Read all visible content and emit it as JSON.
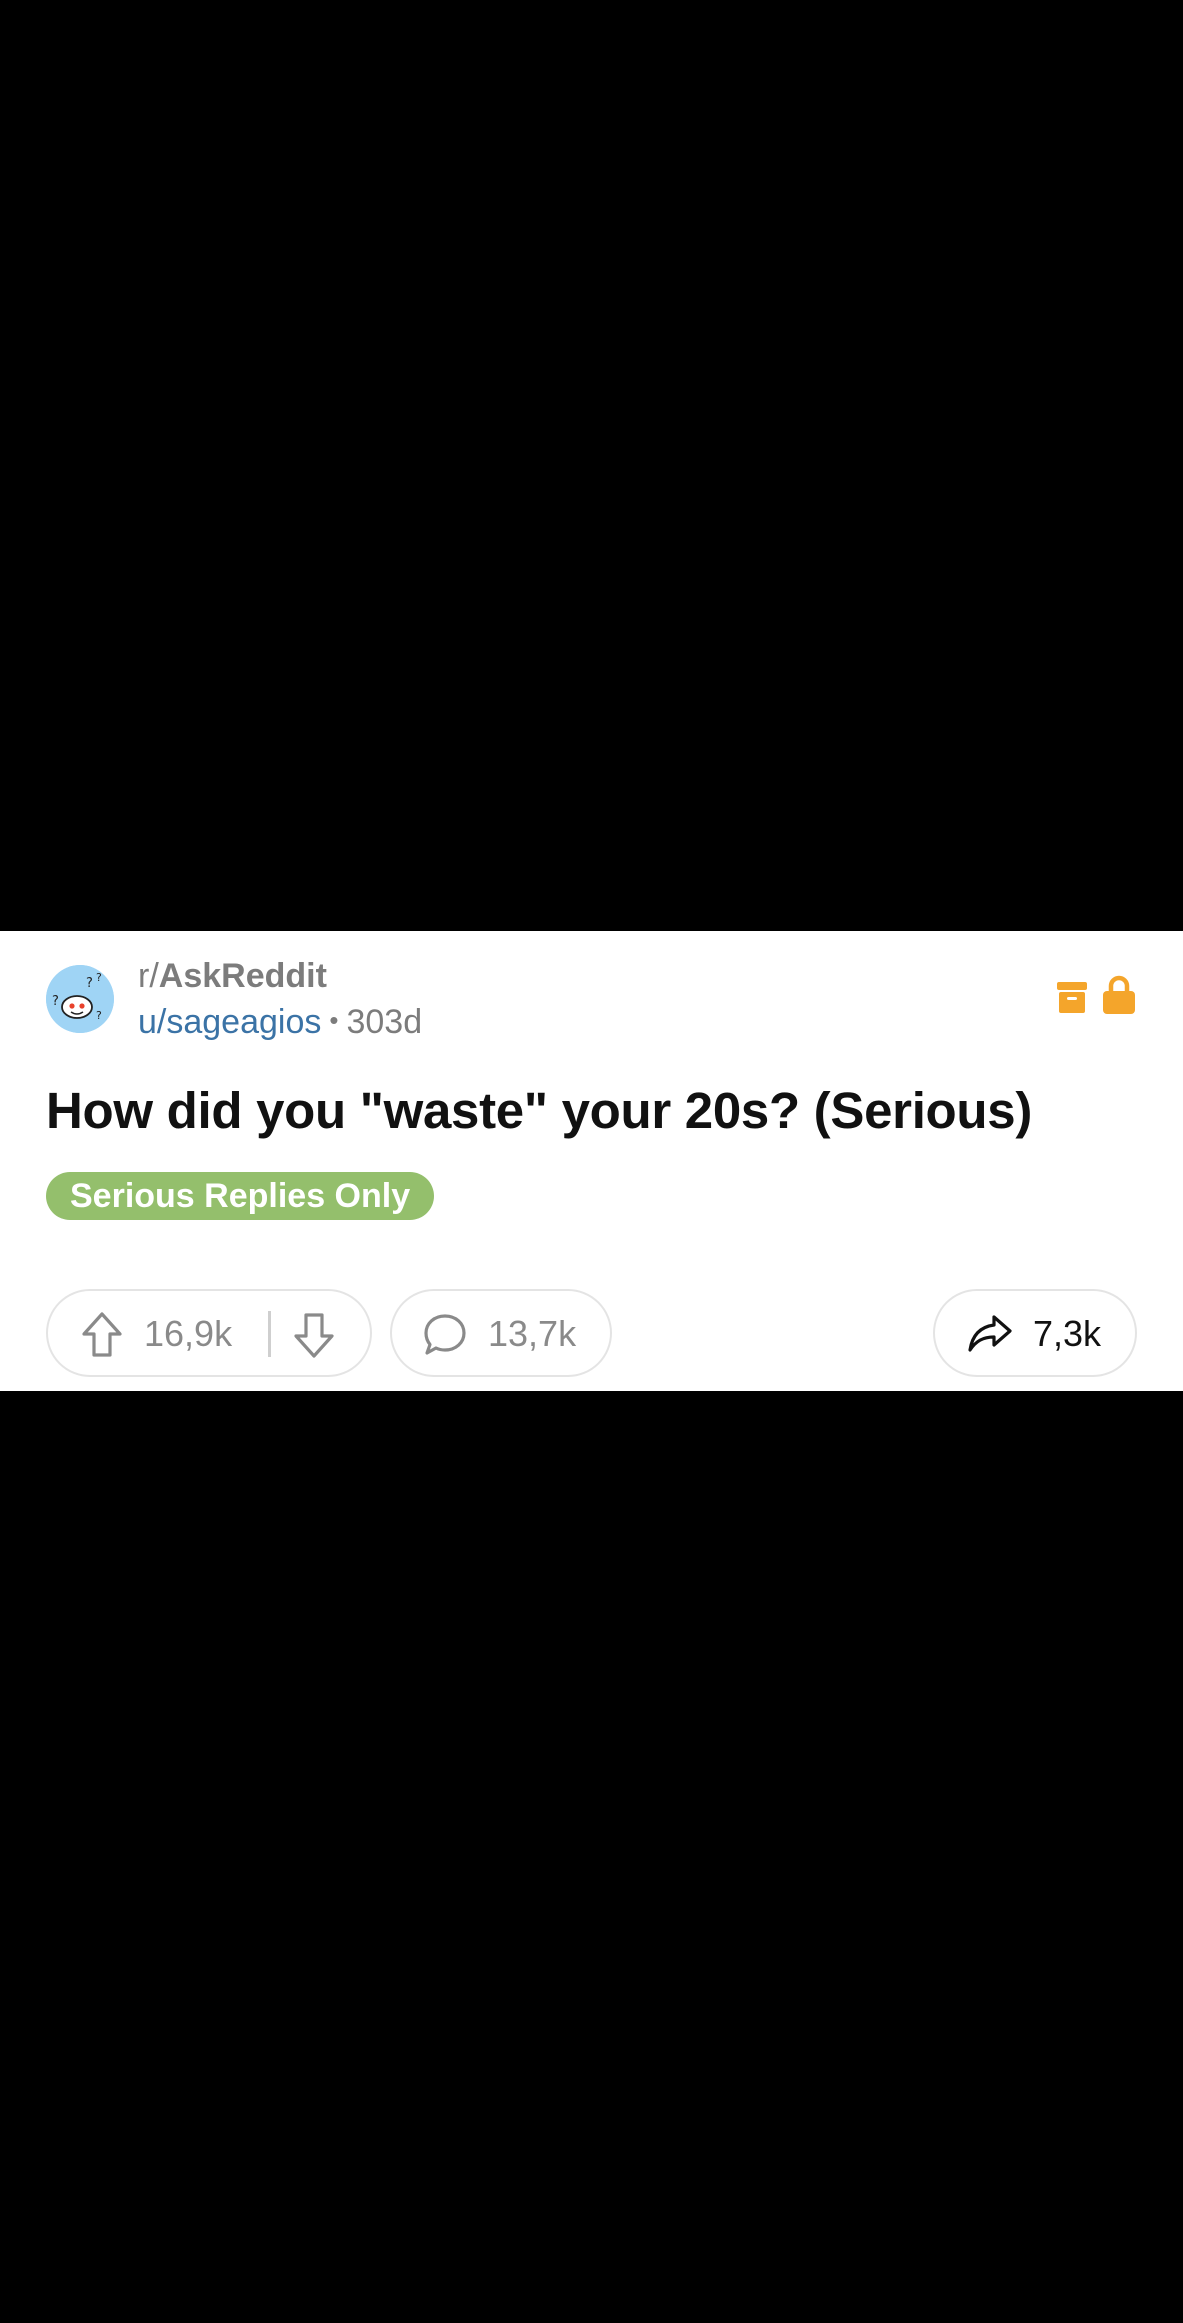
{
  "post": {
    "subreddit_prefix": "r/",
    "subreddit_name": "AskReddit",
    "author": "u/sageagios",
    "separator": "•",
    "age": "303d",
    "title": "How did you \"waste\" your 20s? (Serious)",
    "flair": "Serious Replies Only",
    "status_icons": [
      "archive-icon",
      "lock-icon"
    ]
  },
  "actions": {
    "upvotes": "16,9k",
    "comments": "13,7k",
    "shares": "7,3k"
  },
  "colors": {
    "background": "#000000",
    "card": "#ffffff",
    "flair": "#94bf6c",
    "author_link": "#3b73a6",
    "status_icons": "#f4a52b",
    "muted_text": "#7c7c7c"
  }
}
